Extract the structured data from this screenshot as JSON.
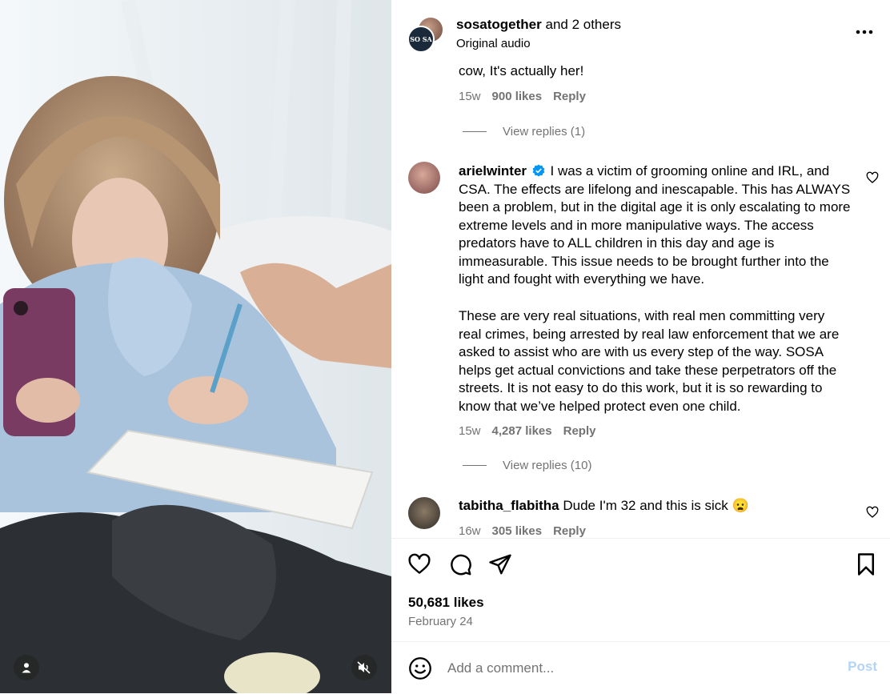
{
  "header": {
    "username": "sosatogether",
    "others": "and 2 others",
    "audio": "Original audio",
    "avatar_text": "SO SA",
    "more_icon": "more-horizontal-icon"
  },
  "comments": [
    {
      "partial_text": "cow, It's actually her!",
      "age": "15w",
      "likes": "900 likes",
      "reply": "Reply",
      "view_replies": "View replies (1)"
    },
    {
      "username": "arielwinter",
      "verified": true,
      "text_p1": "I was a victim of grooming online and IRL, and CSA. The effects are lifelong and inescapable. This has ALWAYS been a problem, but in the digital age it is only escalating to more extreme levels and in more manipulative ways. The access predators have to ALL children in this day and age is immeasurable. This issue needs to be brought further into the light and fought with everything we have.",
      "text_p2": "These are very real situations, with real men committing very real crimes, being arrested by real law enforcement that we are asked to assist who are with us every step of the way. SOSA helps get actual convictions and take these perpetrators off the streets. It is not easy to do this work, but it is so rewarding to know that we’ve helped protect even one child.",
      "age": "15w",
      "likes": "4,287 likes",
      "reply": "Reply",
      "view_replies": "View replies (10)"
    },
    {
      "username": "tabitha_flabitha",
      "text": "Dude I'm 32 and this is sick 😦",
      "age": "16w",
      "likes": "305 likes",
      "reply": "Reply"
    }
  ],
  "actions": {
    "like_icon": "heart-icon",
    "comment_icon": "comment-icon",
    "share_icon": "share-icon",
    "save_icon": "bookmark-icon",
    "likes_count": "50,681 likes",
    "date": "February 24"
  },
  "comment_bar": {
    "placeholder": "Add a comment...",
    "post_label": "Post",
    "emoji_icon": "emoji-icon"
  },
  "media": {
    "tag_icon": "user-tag-icon",
    "mute_icon": "muted-speaker-icon"
  },
  "colors": {
    "secondary_text": "#737373",
    "verified_blue": "#0095f6",
    "post_disabled": "#b3d4f5"
  }
}
